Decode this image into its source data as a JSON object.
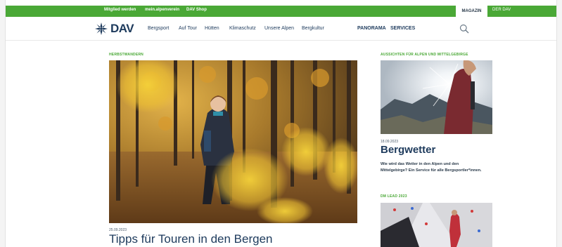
{
  "topbar": {
    "links": [
      "Mitglied werden",
      "mein.alpenverein",
      "DAV Shop"
    ],
    "tab_active": "MAGAZIN",
    "tab_other": "DER DAV"
  },
  "header": {
    "logo_text": "DAV",
    "nav": [
      "Bergsport",
      "Auf Tour",
      "Hütten",
      "Klimaschutz",
      "Unsere Alpen",
      "Bergkultur"
    ],
    "nav_strong": [
      "PANORAMA",
      "SERVICES"
    ]
  },
  "main": {
    "kicker": "HERBSTWANDERN",
    "date": "25.09.2023",
    "headline": "Tipps für Touren in den Bergen"
  },
  "sidebar": {
    "kicker1": "AUSSICHTEN FÜR ALPEN UND MITTELGEBIRGE",
    "date1": "18.09.2023",
    "title1": "Bergwetter",
    "desc1": "Wie wird das Wetter in den Alpen und den Mittelgebirge? Ein Service für alle Bergsportler*innen.",
    "kicker2": "DM LEAD 2023"
  },
  "colors": {
    "brand_green": "#4aa836",
    "brand_navy": "#1d3a5c"
  },
  "icons": {
    "logo": "edelweiss-icon",
    "search": "search-icon"
  }
}
